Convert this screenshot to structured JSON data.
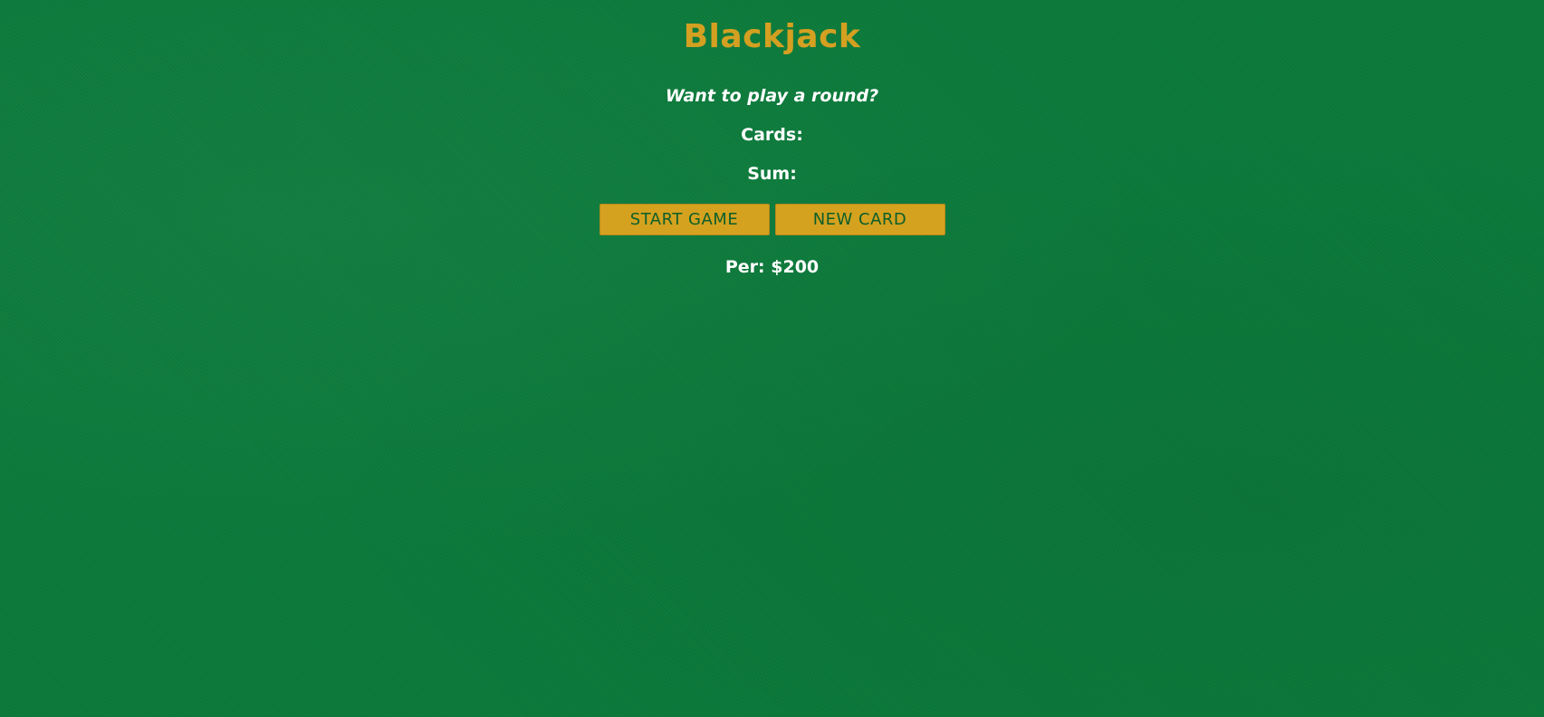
{
  "title": "Blackjack",
  "message": "Want to play a round?",
  "cards_label": "Cards:",
  "sum_label": "Sum:",
  "buttons": {
    "start_game": "START GAME",
    "new_card": "NEW CARD"
  },
  "player_info": "Per: $200",
  "colors": {
    "background": "#0a7a3a",
    "title": "#d4a021",
    "button": "#d4a21f",
    "button_text": "#0d5e2a",
    "text": "#ffffff"
  }
}
